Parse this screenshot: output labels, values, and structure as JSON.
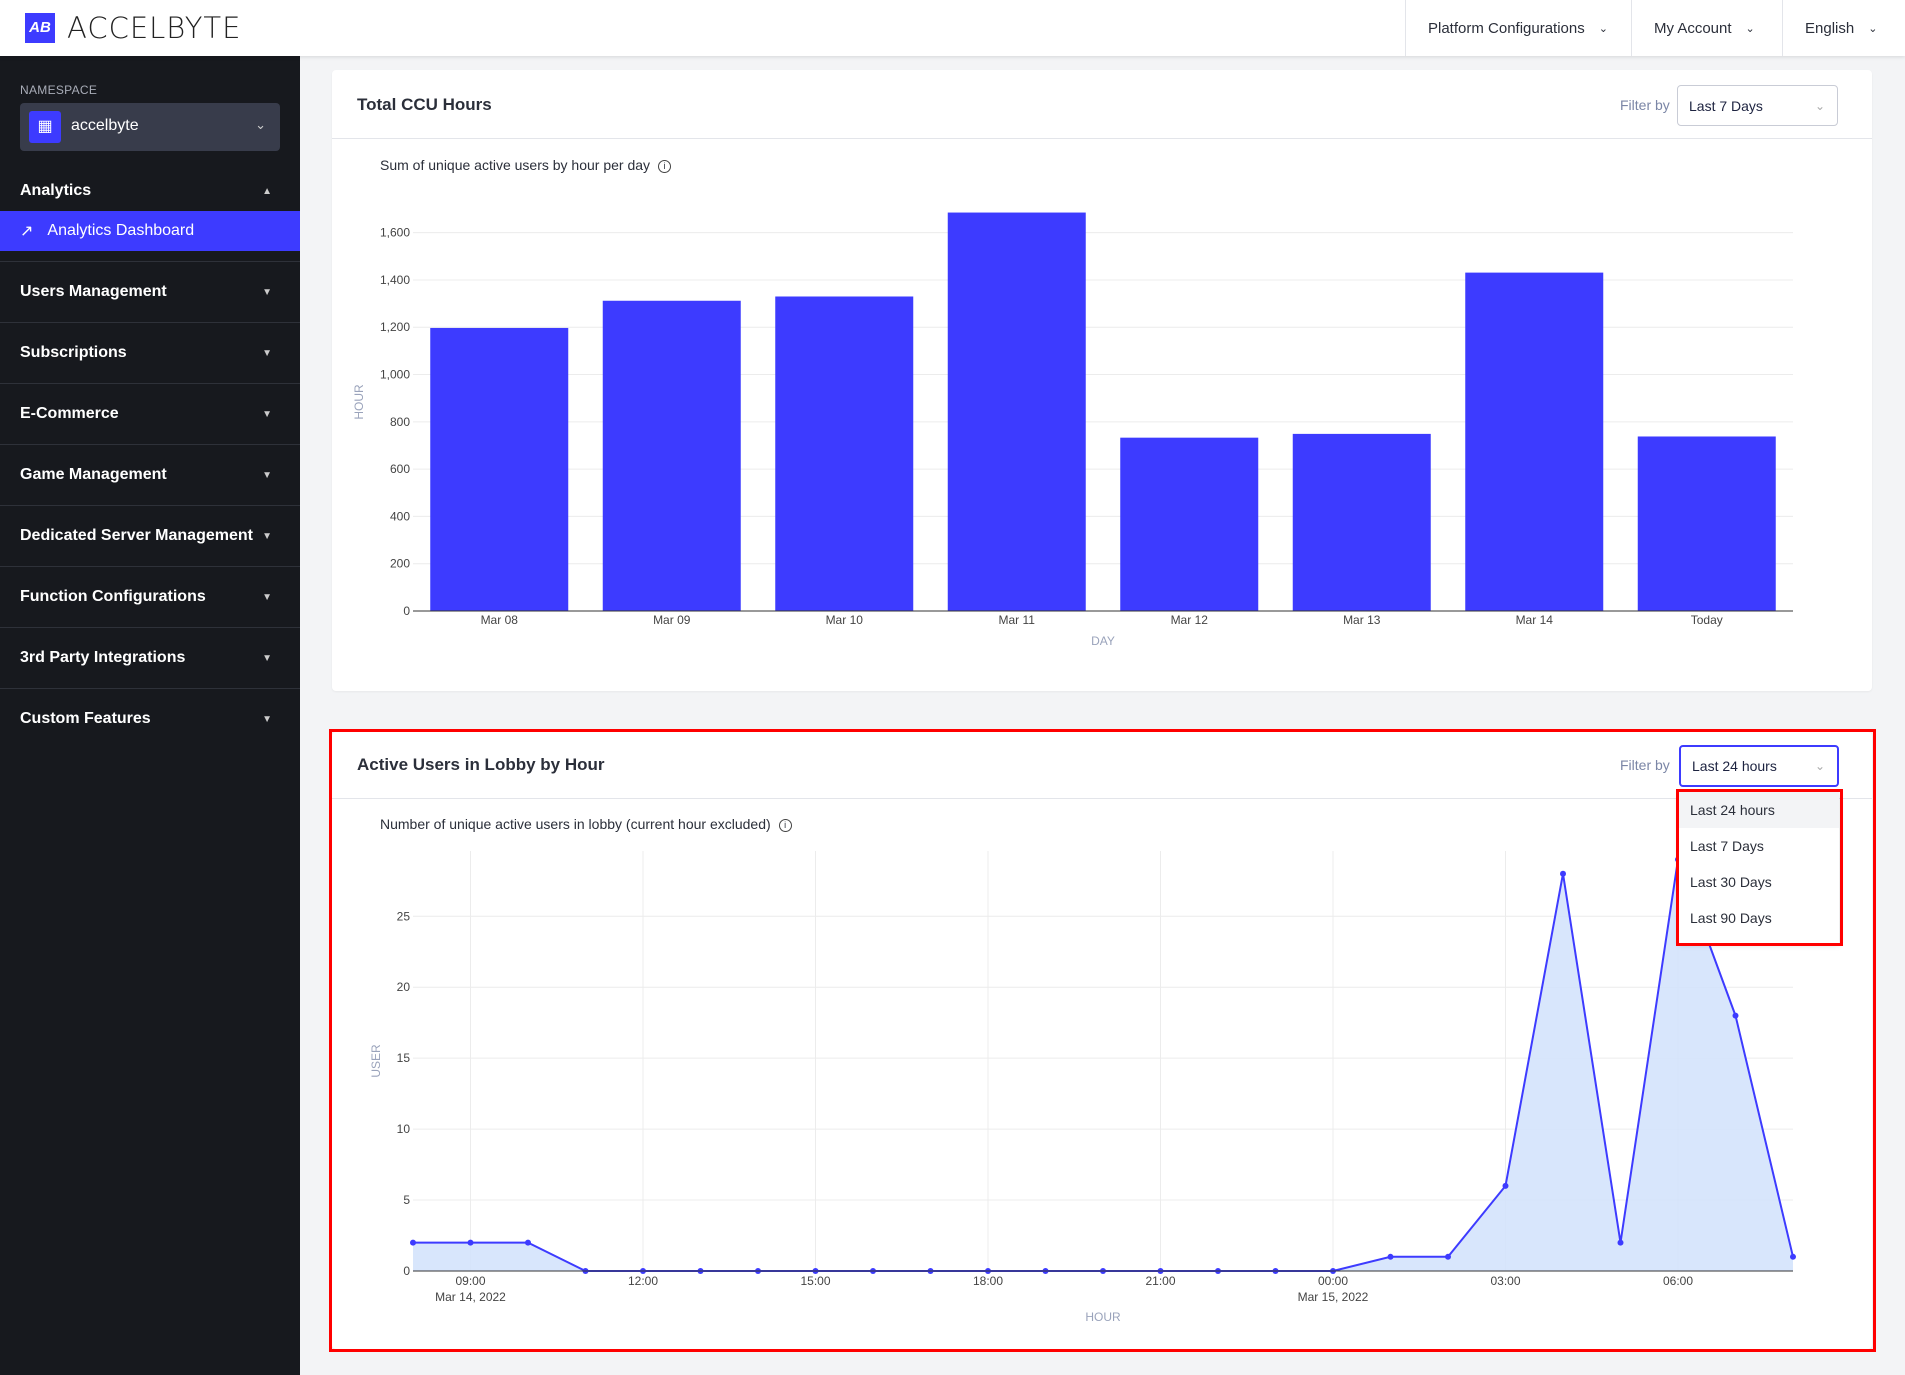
{
  "header": {
    "logo_text": "ACCELBYTE",
    "logo_mark": "AB",
    "nav": [
      {
        "label": "Platform Configurations",
        "icon": "chevron-down-icon"
      },
      {
        "label": "My Account",
        "icon": "chevron-down-icon"
      },
      {
        "label": "English",
        "icon": "chevron-down-icon"
      }
    ]
  },
  "sidebar": {
    "namespace_label": "NAMESPACE",
    "namespace_value": "accelbyte",
    "analytics": {
      "label": "Analytics",
      "active_item": "Analytics Dashboard"
    },
    "items": [
      {
        "label": "Users Management"
      },
      {
        "label": "Subscriptions"
      },
      {
        "label": "E-Commerce"
      },
      {
        "label": "Game Management"
      },
      {
        "label": "Dedicated Server Management"
      },
      {
        "label": "Function Configurations"
      },
      {
        "label": "3rd Party Integrations"
      },
      {
        "label": "Custom Features"
      }
    ]
  },
  "ccu_card": {
    "title": "Total CCU Hours",
    "filter_label": "Filter by",
    "filter_value": "Last 7 Days",
    "subtitle": "Sum of unique active users by hour per day"
  },
  "lobby_card": {
    "title": "Active Users in Lobby by Hour",
    "filter_label": "Filter by",
    "filter_value": "Last 24 hours",
    "subtitle": "Number of unique active users in lobby (current hour excluded)",
    "dropdown_options": [
      "Last 24 hours",
      "Last 7 Days",
      "Last 30 Days",
      "Last 90 Days"
    ],
    "highlighted_option": "Last 24 hours"
  },
  "colors": {
    "accent": "#3d3bff",
    "sidebar_bg": "#17191e",
    "area_fill": "#d4e3fc",
    "highlight": "#ff0000"
  },
  "chart_data": [
    {
      "type": "bar",
      "title": "",
      "xlabel": "DAY",
      "ylabel": "HOUR",
      "ylim": [
        0,
        1700
      ],
      "grid": true,
      "yticks": [
        "0",
        "200",
        "400",
        "600",
        "800",
        "1,000",
        "1,200",
        "1,400",
        "1,600"
      ],
      "categories": [
        "Mar 08",
        "Mar 09",
        "Mar 10",
        "Mar 11",
        "Mar 12",
        "Mar 13",
        "Mar 14",
        "Today"
      ],
      "values": [
        1197,
        1312,
        1330,
        1685,
        733,
        749,
        1431,
        738
      ]
    },
    {
      "type": "area",
      "title": "",
      "xlabel": "HOUR",
      "ylabel": "USER",
      "ylim": [
        0,
        29.6
      ],
      "grid": true,
      "yticks": [
        "0",
        "5",
        "10",
        "15",
        "20",
        "25"
      ],
      "xticks": [
        {
          "label": "09:00",
          "sub": "Mar 14, 2022",
          "hour": 1
        },
        {
          "label": "12:00",
          "sub": "",
          "hour": 4
        },
        {
          "label": "15:00",
          "sub": "",
          "hour": 7
        },
        {
          "label": "18:00",
          "sub": "",
          "hour": 10
        },
        {
          "label": "21:00",
          "sub": "",
          "hour": 13
        },
        {
          "label": "00:00",
          "sub": "Mar 15, 2022",
          "hour": 16
        },
        {
          "label": "03:00",
          "sub": "",
          "hour": 19
        },
        {
          "label": "06:00",
          "sub": "",
          "hour": 22
        }
      ],
      "x": [
        "08:00",
        "09:00",
        "10:00",
        "11:00",
        "12:00",
        "13:00",
        "14:00",
        "15:00",
        "16:00",
        "17:00",
        "18:00",
        "19:00",
        "20:00",
        "21:00",
        "22:00",
        "23:00",
        "00:00",
        "01:00",
        "02:00",
        "03:00",
        "04:00",
        "05:00",
        "06:00",
        "07:00",
        "08:00"
      ],
      "values": [
        2,
        2,
        2,
        0,
        0,
        0,
        0,
        0,
        0,
        0,
        0,
        0,
        0,
        0,
        0,
        0,
        0,
        1,
        1,
        6,
        28,
        2,
        29,
        18,
        1
      ]
    }
  ]
}
